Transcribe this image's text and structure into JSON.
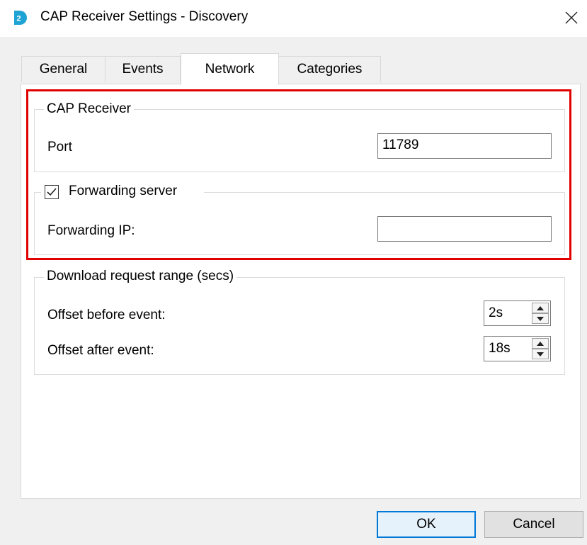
{
  "window": {
    "title": "CAP Receiver Settings - Discovery",
    "app_icon": "discovery-d2-logo",
    "close_icon": "close-x"
  },
  "tabs": [
    {
      "label": "General",
      "active": false
    },
    {
      "label": "Events",
      "active": false
    },
    {
      "label": "Network",
      "active": true
    },
    {
      "label": "Categories",
      "active": false
    }
  ],
  "cap_receiver": {
    "group_label": "CAP Receiver",
    "port_label": "Port",
    "port_value": "11789"
  },
  "forwarding": {
    "checkbox_label": "Forwarding server",
    "checked": true,
    "ip_label": "Forwarding IP:",
    "ip_value": ""
  },
  "download_range": {
    "group_label": "Download request range (secs)",
    "before_label": "Offset before event:",
    "before_value": "2s",
    "after_label": "Offset after event:",
    "after_value": "18s"
  },
  "buttons": {
    "ok": "OK",
    "cancel": "Cancel"
  },
  "colors": {
    "highlight": "#e00000",
    "accent": "#0078d7",
    "logo": "#1fa3d4"
  }
}
